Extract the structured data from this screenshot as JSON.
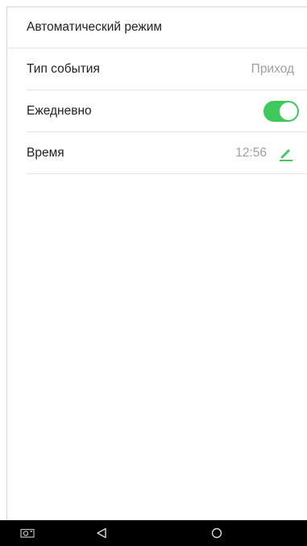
{
  "header": {
    "title": "Автоматический режим"
  },
  "rows": [
    {
      "label": "Тип события",
      "value": "Приход"
    },
    {
      "label": "Ежедневно",
      "toggle_on": true
    },
    {
      "label": "Время",
      "value": "12:56"
    }
  ],
  "colors": {
    "accent": "#3fc95a",
    "value_text": "#a0a0a0",
    "nav_bar": "#000000"
  },
  "icons": {
    "edit": "pencil-icon",
    "nav_screenshot": "screenshot-icon",
    "nav_back": "back-triangle-icon",
    "nav_home": "home-circle-icon"
  }
}
